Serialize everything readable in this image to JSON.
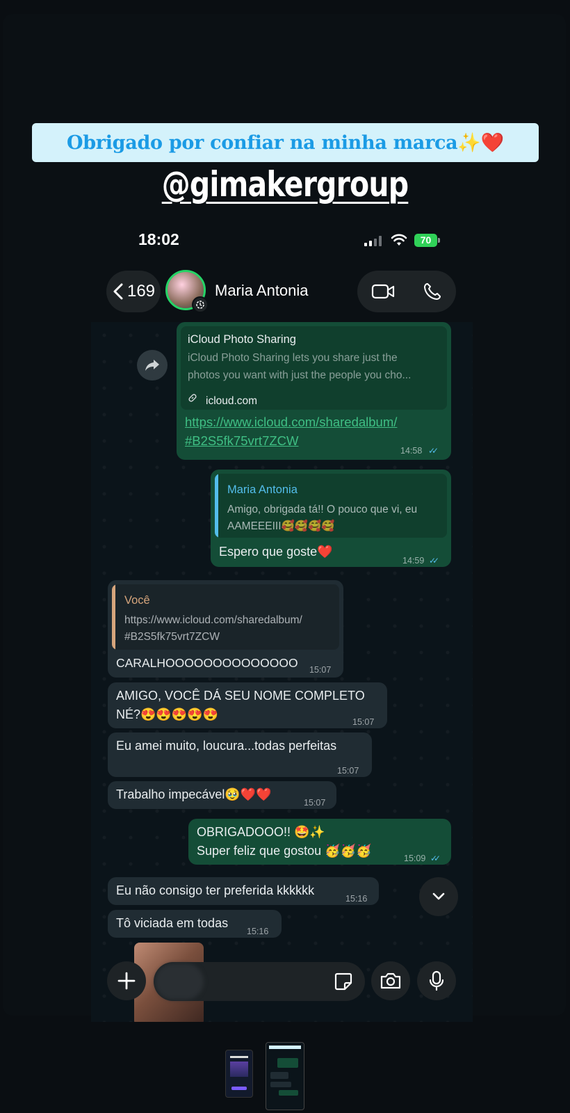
{
  "story": {
    "banner_text": "Obrigado por confiar na minha marca✨❤️",
    "handle": "@gimakergroup"
  },
  "status_bar": {
    "time": "18:02",
    "battery": "70"
  },
  "header": {
    "back_count": "169",
    "contact_name": "Maria Antonia"
  },
  "messages": {
    "link_preview": {
      "title": "iCloud Photo Sharing",
      "description_line1": "iCloud Photo Sharing lets you share just the",
      "description_line2": "photos you want with just the people you cho...",
      "domain": "icloud.com",
      "url_line1": "https://www.icloud.com/sharedalbum/",
      "url_line2": "#B2S5fk75vrt7ZCW",
      "time": "14:58"
    },
    "reply_out": {
      "quoted_author": "Maria Antonia",
      "quoted_line1": "Amigo, obrigada tá!! O pouco que vi, eu",
      "quoted_line2": "AAMEEEIII🥰🥰🥰🥰",
      "text": "Espero que goste❤️",
      "time": "14:59"
    },
    "reply_in": {
      "quoted_author": "Você",
      "quoted_line1": "https://www.icloud.com/sharedalbum/",
      "quoted_line2": "#B2S5fk75vrt7ZCW",
      "text": "CARALHOOOOOOOOOOOOOO",
      "time": "15:07"
    },
    "msg_nome": {
      "line1": "AMIGO, VOCÊ DÁ SEU NOME COMPLETO",
      "line2": "NÉ?😍😍😍😍😍",
      "time": "15:07"
    },
    "msg_amei": {
      "text": "Eu amei muito, loucura...todas perfeitas",
      "time": "15:07"
    },
    "msg_trabalho": {
      "text": "Trabalho impecável🥹❤️❤️",
      "time": "15:07"
    },
    "msg_obrigado": {
      "line1": "OBRIGADOOO!! 🤩✨",
      "line2": "Super feliz que gostou 🥳🥳🥳",
      "time": "15:09"
    },
    "msg_preferida": {
      "text": "Eu não consigo ter preferida kkkkkk",
      "time": "15:16"
    },
    "msg_viciada": {
      "text": "Tô viciada em todas",
      "time": "15:16"
    }
  },
  "colors": {
    "outgoing_bubble": "#144d37",
    "incoming_bubble": "#202c33",
    "accent_green": "#25d366",
    "read_tick": "#53bdeb",
    "banner_bg": "#d4f2fb",
    "banner_text": "#1b9be5"
  }
}
